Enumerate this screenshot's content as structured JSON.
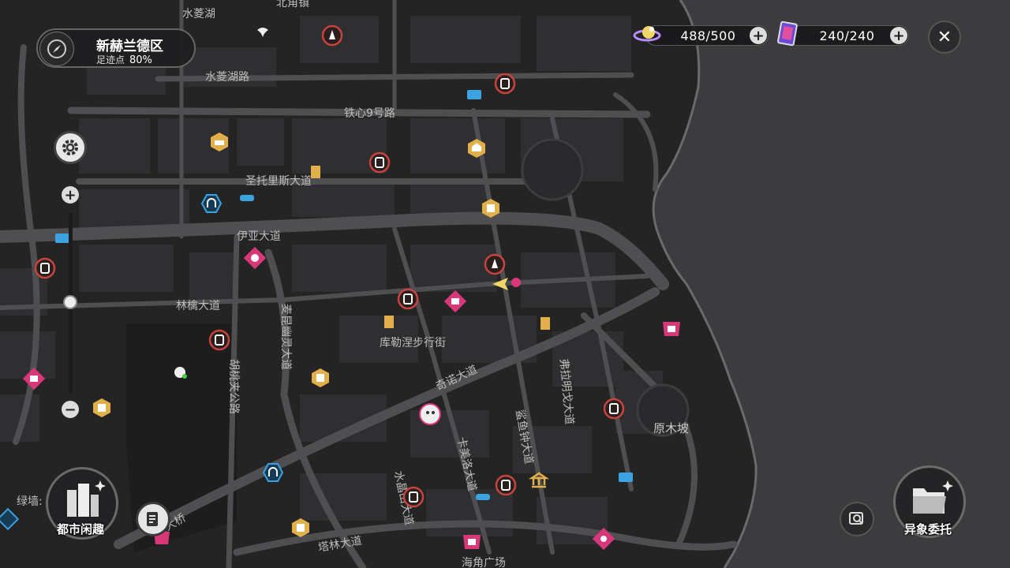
{
  "region": {
    "name": "新赫兰德区",
    "footprint_label": "足迹点",
    "footprint_value": "80%"
  },
  "resources": [
    {
      "icon": "stamina-orb-icon",
      "value": "488/500"
    },
    {
      "icon": "card-icon",
      "value": "240/240"
    }
  ],
  "map_labels": {
    "shuiling_lake": "水菱湖",
    "north_port": "北角镇",
    "shuiling_road": "水菱湖路",
    "tiexin_9": "铁心9号路",
    "santorris": "圣托里斯大道",
    "iya": "伊亚大道",
    "linqin": "林檎大道",
    "kulepan": "库勒涅步行街",
    "qinuo": "奇诺大道",
    "yuanmu": "原木坡",
    "hutao": "胡桃夹公路",
    "mokun": "麦昆幽灵大道",
    "fulaming": "弗拉明戈大道",
    "shayu": "鲨鱼钟大道",
    "kamelo": "卡美洛大道",
    "shuimu": "水晶山大道",
    "talin": "塔林大道",
    "haijiao": "海角广场",
    "lvqiang": "绿墙:",
    "bridge": "蓬大桥"
  },
  "buttons": {
    "city_leisure": "都市闲趣",
    "anomaly_commission": "异象委托"
  },
  "colors": {
    "water": "#3c3c3e",
    "land": "#282829",
    "road": "#555558",
    "block": "#343436",
    "pin_red": "#c7443e",
    "pin_pink": "#d8387a",
    "pin_blue": "#3aa3e0",
    "pin_gold": "#e2b04a"
  }
}
